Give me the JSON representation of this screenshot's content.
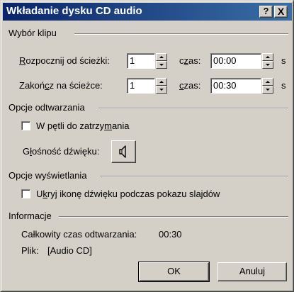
{
  "window": {
    "title": "Wkładanie dysku CD audio",
    "help_label": "?",
    "close_label": "X"
  },
  "clip": {
    "group_title": "Wybór klipu",
    "start": {
      "label_prefix": "",
      "label_mnemonic": "R",
      "label_rest": "ozpocznij od ścieżki:",
      "track_value": "1",
      "time_label_prefix": "c",
      "time_label_mnemonic": "z",
      "time_label_rest": "as:",
      "time_value": "00:00",
      "unit": "s"
    },
    "end": {
      "label_prefix": "Zakoń",
      "label_mnemonic": "c",
      "label_rest": "z na ścieżce:",
      "track_value": "1",
      "time_label_prefix": "",
      "time_label_mnemonic": "c",
      "time_label_rest": "zas:",
      "time_value": "00:30",
      "unit": "s"
    }
  },
  "playback": {
    "group_title": "Opcje odtwarzania",
    "loop_prefix": "W pętli do zatrzy",
    "loop_mnemonic": "m",
    "loop_rest": "ania",
    "loop_checked": false,
    "volume_prefix": "G",
    "volume_mnemonic": "ł",
    "volume_rest": "ośność dźwięku:",
    "volume_icon": "speaker-icon"
  },
  "display": {
    "group_title": "Opcje wyświetlania",
    "hide_prefix": "U",
    "hide_mnemonic": "k",
    "hide_rest": "ryj ikonę dźwięku podczas pokazu slajdów",
    "hide_checked": false
  },
  "info": {
    "group_title": "Informacje",
    "total_time_label": "Całkowity czas odtwarzania:",
    "total_time_value": "00:30",
    "file_label": "Plik:",
    "file_value": "[Audio CD]"
  },
  "buttons": {
    "ok": "OK",
    "cancel": "Anuluj"
  },
  "colors": {
    "face": "#d4d0c8",
    "title_start": "#0a246a",
    "title_end": "#3a6ea5"
  }
}
